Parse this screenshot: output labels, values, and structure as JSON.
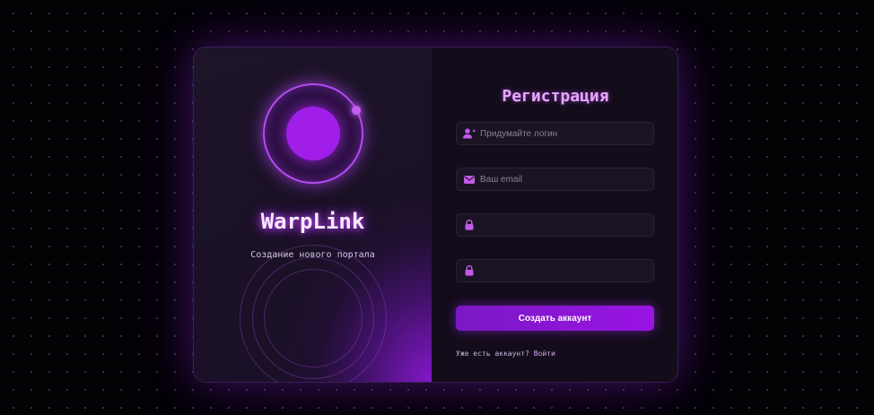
{
  "brand": {
    "name": "WarpLink",
    "tagline": "Создание нового портала"
  },
  "form": {
    "title": "Регистрация",
    "fields": [
      {
        "icon": "user-plus-icon",
        "placeholder": "Придумайте логин",
        "type": "text"
      },
      {
        "icon": "envelope-icon",
        "placeholder": "Ваш email",
        "type": "email"
      },
      {
        "icon": "lock-icon",
        "placeholder": "",
        "type": "password"
      },
      {
        "icon": "lock-icon",
        "placeholder": "",
        "type": "password"
      }
    ],
    "submit_label": "Создать аккаунт",
    "login_prompt": "Уже есть аккаунт?",
    "login_link": "Войти"
  },
  "colors": {
    "background": "#030205",
    "accent": "#9a14e4",
    "icon": "#c15ae6",
    "title": "#e6a6ff",
    "brand_glow": "#c04cff"
  }
}
